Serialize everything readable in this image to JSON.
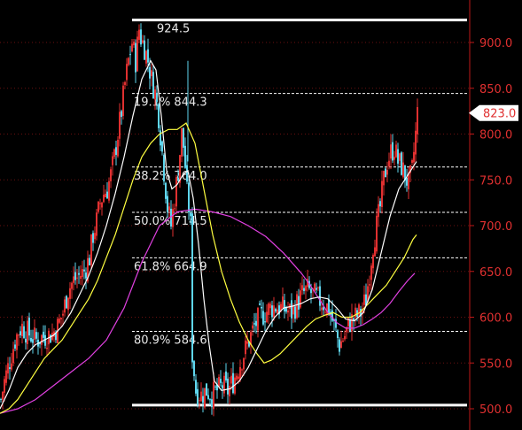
{
  "chart_data": {
    "type": "candlestick",
    "y_axis": {
      "ticks": [
        "500.0",
        "550.0",
        "600.0",
        "650.0",
        "700.0",
        "750.0",
        "800.0",
        "850.0",
        "900.0"
      ],
      "tick_values": [
        500,
        550,
        600,
        650,
        700,
        750,
        800,
        850,
        900
      ],
      "position": "right"
    },
    "last_price": {
      "label": "823.0",
      "value": 823.0
    },
    "high_label": {
      "text": "924.5",
      "value": 924.5
    },
    "fibonacci": {
      "high": 924.5,
      "low": 504.0,
      "levels": [
        {
          "label": "19.1% 844.3",
          "value": 844.3
        },
        {
          "label": "38.2% 764.0",
          "value": 764.0
        },
        {
          "label": "50.0% 714.5",
          "value": 714.5
        },
        {
          "label": "61.8% 664.9",
          "value": 664.9
        },
        {
          "label": "80.9% 584.6",
          "value": 584.6
        }
      ]
    },
    "close_path": [
      [
        0,
        510
      ],
      [
        4,
        530
      ],
      [
        8,
        545
      ],
      [
        12,
        560
      ],
      [
        16,
        575
      ],
      [
        20,
        585
      ],
      [
        24,
        590
      ],
      [
        28,
        585
      ],
      [
        34,
        580
      ],
      [
        40,
        575
      ],
      [
        46,
        578
      ],
      [
        52,
        580
      ],
      [
        58,
        582
      ],
      [
        64,
        590
      ],
      [
        70,
        605
      ],
      [
        76,
        630
      ],
      [
        82,
        640
      ],
      [
        88,
        645
      ],
      [
        94,
        650
      ],
      [
        100,
        665
      ],
      [
        104,
        690
      ],
      [
        108,
        705
      ],
      [
        112,
        725
      ],
      [
        116,
        735
      ],
      [
        120,
        740
      ],
      [
        124,
        755
      ],
      [
        128,
        775
      ],
      [
        132,
        800
      ],
      [
        136,
        825
      ],
      [
        140,
        855
      ],
      [
        144,
        880
      ],
      [
        148,
        900
      ],
      [
        152,
        880
      ],
      [
        156,
        915
      ],
      [
        158,
        905
      ],
      [
        162,
        895
      ],
      [
        166,
        880
      ],
      [
        170,
        860
      ],
      [
        174,
        845
      ],
      [
        178,
        820
      ],
      [
        180,
        800
      ],
      [
        184,
        760
      ],
      [
        188,
        720
      ],
      [
        192,
        700
      ],
      [
        196,
        730
      ],
      [
        200,
        760
      ],
      [
        204,
        800
      ],
      [
        207,
        780
      ],
      [
        210,
        735
      ],
      [
        212,
        720
      ],
      [
        214,
        700
      ],
      [
        216,
        560
      ],
      [
        220,
        520
      ],
      [
        226,
        515
      ],
      [
        232,
        520
      ],
      [
        238,
        515
      ],
      [
        244,
        520
      ],
      [
        250,
        525
      ],
      [
        256,
        520
      ],
      [
        262,
        530
      ],
      [
        268,
        545
      ],
      [
        274,
        560
      ],
      [
        280,
        575
      ],
      [
        286,
        590
      ],
      [
        292,
        600
      ],
      [
        298,
        605
      ],
      [
        304,
        610
      ],
      [
        310,
        612
      ],
      [
        316,
        610
      ],
      [
        322,
        608
      ],
      [
        328,
        605
      ],
      [
        334,
        615
      ],
      [
        340,
        625
      ],
      [
        346,
        630
      ],
      [
        352,
        625
      ],
      [
        358,
        620
      ],
      [
        364,
        615
      ],
      [
        370,
        610
      ],
      [
        376,
        590
      ],
      [
        382,
        570
      ],
      [
        388,
        580
      ],
      [
        394,
        595
      ],
      [
        400,
        600
      ],
      [
        406,
        605
      ],
      [
        412,
        620
      ],
      [
        416,
        650
      ],
      [
        420,
        680
      ],
      [
        424,
        700
      ],
      [
        428,
        720
      ],
      [
        432,
        750
      ],
      [
        436,
        770
      ],
      [
        440,
        780
      ],
      [
        444,
        785
      ],
      [
        448,
        770
      ],
      [
        452,
        765
      ],
      [
        456,
        755
      ],
      [
        460,
        745
      ],
      [
        464,
        760
      ],
      [
        468,
        800
      ],
      [
        470,
        823
      ]
    ],
    "ma_short": [
      [
        0,
        500
      ],
      [
        10,
        520
      ],
      [
        20,
        545
      ],
      [
        30,
        560
      ],
      [
        40,
        570
      ],
      [
        50,
        575
      ],
      [
        60,
        580
      ],
      [
        70,
        590
      ],
      [
        80,
        605
      ],
      [
        90,
        625
      ],
      [
        100,
        645
      ],
      [
        110,
        670
      ],
      [
        120,
        700
      ],
      [
        130,
        735
      ],
      [
        140,
        775
      ],
      [
        150,
        820
      ],
      [
        160,
        860
      ],
      [
        170,
        880
      ],
      [
        176,
        870
      ],
      [
        182,
        820
      ],
      [
        188,
        760
      ],
      [
        194,
        740
      ],
      [
        200,
        745
      ],
      [
        206,
        755
      ],
      [
        212,
        760
      ],
      [
        218,
        730
      ],
      [
        224,
        680
      ],
      [
        230,
        620
      ],
      [
        236,
        570
      ],
      [
        242,
        530
      ],
      [
        250,
        520
      ],
      [
        260,
        522
      ],
      [
        270,
        530
      ],
      [
        280,
        545
      ],
      [
        290,
        565
      ],
      [
        300,
        585
      ],
      [
        310,
        600
      ],
      [
        320,
        610
      ],
      [
        330,
        612
      ],
      [
        340,
        615
      ],
      [
        350,
        620
      ],
      [
        360,
        622
      ],
      [
        370,
        620
      ],
      [
        380,
        610
      ],
      [
        390,
        598
      ],
      [
        400,
        596
      ],
      [
        410,
        605
      ],
      [
        420,
        630
      ],
      [
        430,
        670
      ],
      [
        440,
        710
      ],
      [
        450,
        740
      ],
      [
        460,
        755
      ],
      [
        470,
        770
      ]
    ],
    "ma_mid": [
      [
        0,
        495
      ],
      [
        10,
        500
      ],
      [
        20,
        510
      ],
      [
        30,
        525
      ],
      [
        40,
        540
      ],
      [
        50,
        555
      ],
      [
        60,
        565
      ],
      [
        70,
        575
      ],
      [
        80,
        590
      ],
      [
        90,
        605
      ],
      [
        100,
        620
      ],
      [
        110,
        640
      ],
      [
        120,
        665
      ],
      [
        130,
        690
      ],
      [
        140,
        720
      ],
      [
        150,
        750
      ],
      [
        160,
        775
      ],
      [
        170,
        790
      ],
      [
        180,
        800
      ],
      [
        190,
        805
      ],
      [
        200,
        805
      ],
      [
        210,
        812
      ],
      [
        220,
        790
      ],
      [
        230,
        740
      ],
      [
        240,
        690
      ],
      [
        250,
        650
      ],
      [
        260,
        620
      ],
      [
        270,
        595
      ],
      [
        280,
        575
      ],
      [
        290,
        560
      ],
      [
        298,
        550
      ],
      [
        306,
        553
      ],
      [
        316,
        560
      ],
      [
        326,
        570
      ],
      [
        336,
        580
      ],
      [
        346,
        590
      ],
      [
        356,
        598
      ],
      [
        366,
        602
      ],
      [
        376,
        605
      ],
      [
        386,
        600
      ],
      [
        396,
        600
      ],
      [
        406,
        605
      ],
      [
        416,
        615
      ],
      [
        426,
        625
      ],
      [
        436,
        635
      ],
      [
        446,
        650
      ],
      [
        456,
        665
      ],
      [
        466,
        685
      ],
      [
        470,
        690
      ]
    ],
    "ma_long": [
      [
        0,
        495
      ],
      [
        20,
        500
      ],
      [
        40,
        510
      ],
      [
        60,
        525
      ],
      [
        80,
        540
      ],
      [
        100,
        555
      ],
      [
        120,
        575
      ],
      [
        140,
        610
      ],
      [
        160,
        660
      ],
      [
        180,
        700
      ],
      [
        200,
        715
      ],
      [
        220,
        718
      ],
      [
        240,
        715
      ],
      [
        260,
        710
      ],
      [
        280,
        700
      ],
      [
        300,
        688
      ],
      [
        320,
        670
      ],
      [
        340,
        648
      ],
      [
        350,
        635
      ],
      [
        360,
        620
      ],
      [
        370,
        605
      ],
      [
        380,
        594
      ],
      [
        390,
        588
      ],
      [
        400,
        588
      ],
      [
        410,
        592
      ],
      [
        420,
        598
      ],
      [
        430,
        605
      ],
      [
        440,
        615
      ],
      [
        450,
        628
      ],
      [
        460,
        640
      ],
      [
        468,
        648
      ]
    ],
    "colors": {
      "background": "#000000",
      "grid": "#6b1010",
      "axis_line": "#c01818",
      "tick_label": "#e03030",
      "bull_candle": "#e03030",
      "bear_candle": "#5fd6ee",
      "fib_line": "#ffffff",
      "ma_short": "#ffffff",
      "ma_mid": "#ffff40",
      "ma_long": "#e040e0",
      "price_badge_bg": "#ffffff",
      "price_badge_text": "#e02020"
    }
  }
}
